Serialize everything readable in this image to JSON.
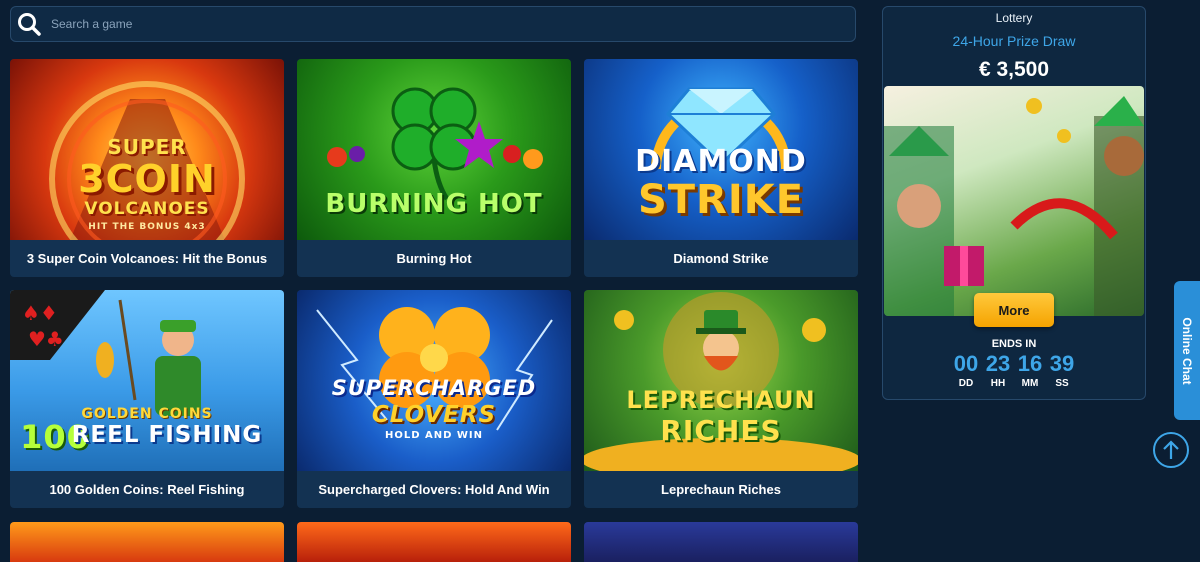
{
  "search": {
    "placeholder": "Search a game",
    "icon": "search-icon"
  },
  "games": [
    {
      "title": "3 Super Coin Volcanoes: Hit the Bonus",
      "art_line1": "SUPER",
      "art_line2": "3COIN",
      "art_line3": "VOLCANOES",
      "art_line4": "HIT THE BONUS 4x3"
    },
    {
      "title": "Burning Hot",
      "art_line1": "BURNING HOT"
    },
    {
      "title": "Diamond Strike",
      "art_line1": "DIAMOND",
      "art_line2": "STRIKE"
    },
    {
      "title": "100 Golden Coins: Reel Fishing",
      "art_line1": "GOLDEN COINS",
      "art_line2": "100",
      "art_line3": "REEL FISHING"
    },
    {
      "title": "Supercharged Clovers: Hold And Win",
      "art_line1": "SUPERCHARGED",
      "art_line2": "CLOVERS",
      "art_line3": "HOLD AND WIN"
    },
    {
      "title": "Leprechaun Riches",
      "art_line1": "LEPRECHAUN",
      "art_line2": "RICHES"
    }
  ],
  "lottery": {
    "label": "Lottery",
    "subtitle": "24-Hour Prize Draw",
    "prize": "€ 3,500",
    "more_label": "More",
    "ends_in_label": "ENDS IN",
    "countdown": [
      {
        "value": "00",
        "unit": "DD"
      },
      {
        "value": "23",
        "unit": "HH"
      },
      {
        "value": "16",
        "unit": "MM"
      },
      {
        "value": "39",
        "unit": "SS"
      }
    ]
  },
  "online_chat": {
    "label": "Online Chat"
  },
  "colors": {
    "background": "#0b1e33",
    "card": "#133252",
    "accent": "#3ea6e8",
    "button": "#f5a300"
  }
}
